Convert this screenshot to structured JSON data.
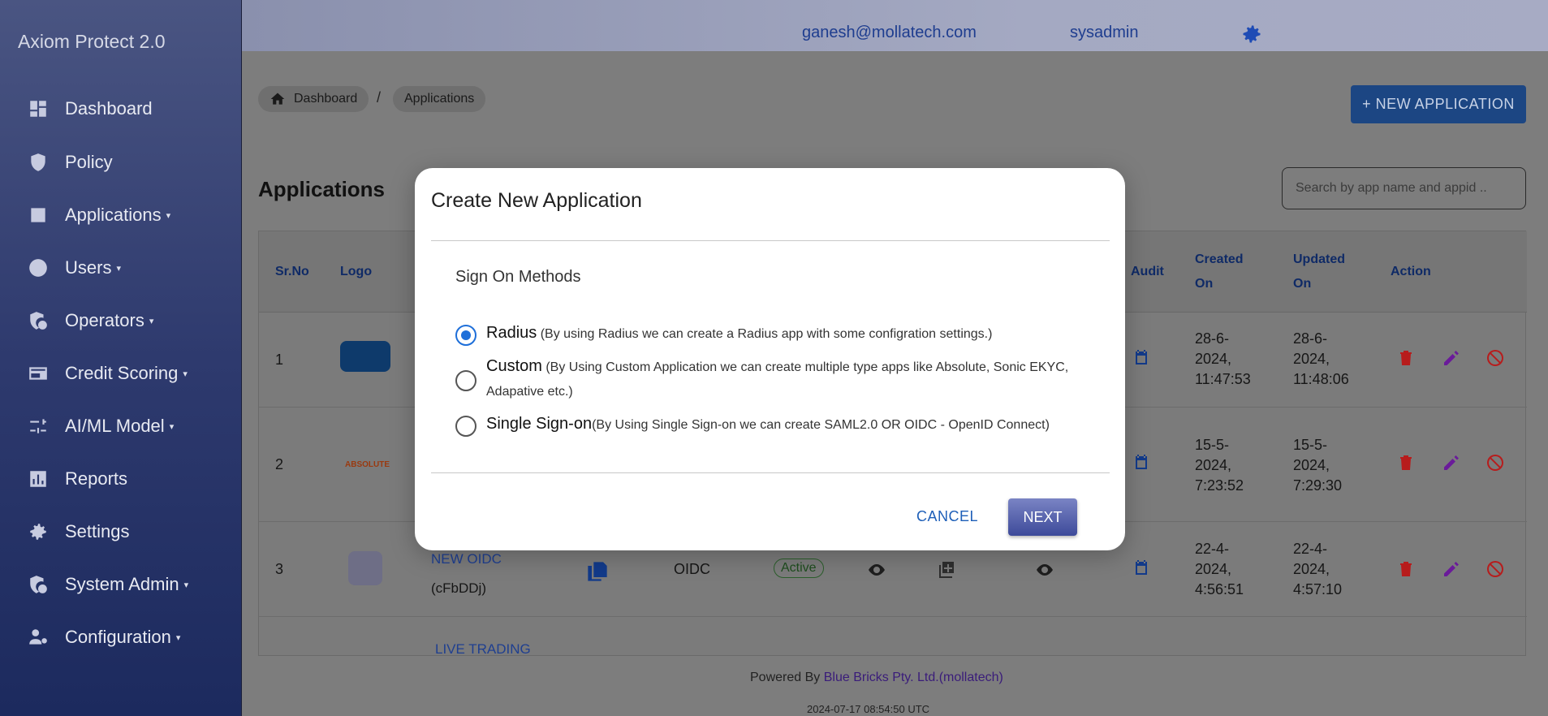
{
  "app": {
    "brand": "Axiom Protect 2.0"
  },
  "sidebar": {
    "items": [
      {
        "label": "Dashboard",
        "icon": "dashboard-icon"
      },
      {
        "label": "Policy",
        "icon": "shield-icon"
      },
      {
        "label": "Applications",
        "icon": "applications-icon",
        "caret": "▾"
      },
      {
        "label": "Users",
        "icon": "user-circle-icon",
        "caret": "▾"
      },
      {
        "label": "Operators",
        "icon": "operators-icon",
        "caret": "▾"
      },
      {
        "label": "Credit Scoring",
        "icon": "credit-card-icon",
        "caret": "▾"
      },
      {
        "label": "AI/ML Model",
        "icon": "sliders-icon",
        "caret": "▾"
      },
      {
        "label": "Reports",
        "icon": "bar-chart-icon"
      },
      {
        "label": "Settings",
        "icon": "gear-icon"
      },
      {
        "label": "System Admin",
        "icon": "system-admin-icon",
        "caret": "▾"
      },
      {
        "label": "Configuration",
        "icon": "configuration-icon",
        "caret": "▾"
      }
    ]
  },
  "topbar": {
    "email": "ganesh@mollatech.com",
    "user": "sysadmin",
    "settings_icon": "gear-icon"
  },
  "breadcrumb": {
    "home": "Dashboard",
    "separator": "/",
    "current": "Applications"
  },
  "header": {
    "new_button": "+ NEW APPLICATION",
    "title": "Applications",
    "search_placeholder": "Search by app name and appid .."
  },
  "table": {
    "columns": [
      "Sr.No",
      "Logo",
      "Audit",
      "Created On",
      "Updated On",
      "Action"
    ],
    "rows": [
      {
        "sr": "1",
        "created": [
          "28-6-",
          "2024,",
          "11:47:53"
        ],
        "updated": [
          "28-6-",
          "2024,",
          "11:48:06"
        ]
      },
      {
        "sr": "2",
        "logo_text": "ABSOLUTE",
        "created": [
          "15-5-",
          "2024,",
          "7:23:52"
        ],
        "updated": [
          "15-5-",
          "2024,",
          "7:29:30"
        ]
      },
      {
        "sr": "3",
        "name": "NEW OIDC",
        "appid": "(cFbDDj)",
        "type": "OIDC",
        "status": "Active",
        "created": [
          "22-4-",
          "2024,",
          "4:56:51"
        ],
        "updated": [
          "22-4-",
          "2024,",
          "4:57:10"
        ]
      },
      {
        "name": "LIVE TRADING"
      }
    ]
  },
  "footer": {
    "powered": "Powered By ",
    "company": "Blue Bricks Pty. Ltd.(mollatech)",
    "timestamp": "2024-07-17 08:54:50 UTC"
  },
  "modal": {
    "title": "Create New Application",
    "section": "Sign On Methods",
    "options": [
      {
        "name": "Radius",
        "desc": " (By using Radius we can create a Radius app with some configration settings.)",
        "selected": true
      },
      {
        "name": "Custom",
        "desc": " (By Using Custom Application we can create multiple type apps like Absolute, Sonic EKYC,",
        "desc2": "Adapative etc.)",
        "selected": false
      },
      {
        "name": "Single Sign-on",
        "desc": "(By Using Single Sign-on we can create SAML2.0 OR OIDC - OpenID Connect)",
        "selected": false
      }
    ],
    "cancel": "CANCEL",
    "next": "NEXT"
  },
  "colors": {
    "accent": "#1e6fd9",
    "primary_button": "#1c4683",
    "delete": "#c62828",
    "edit": "#7b1fa2"
  }
}
